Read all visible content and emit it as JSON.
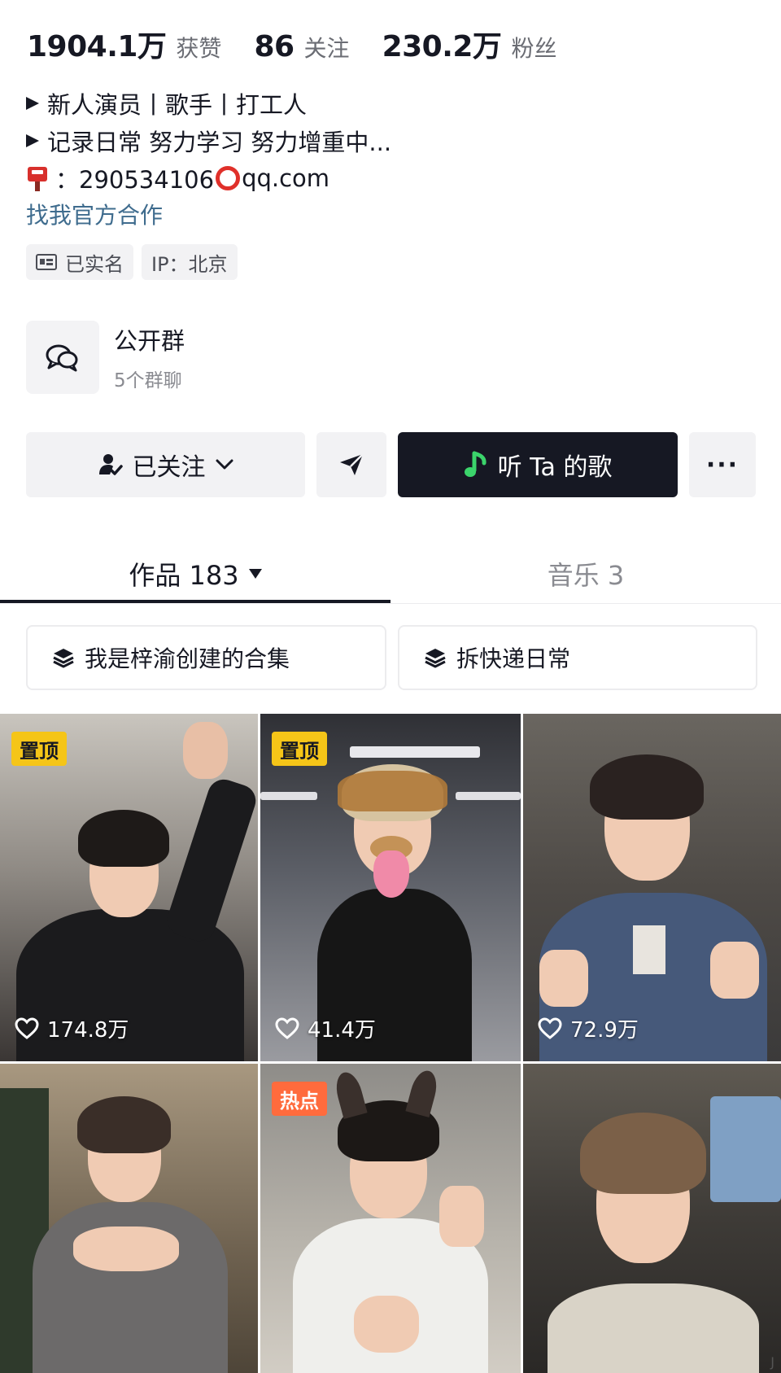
{
  "stats": {
    "likes_value": "1904.1万",
    "likes_label": "获赞",
    "following_value": "86",
    "following_label": "关注",
    "followers_value": "230.2万",
    "followers_label": "粉丝"
  },
  "bio": {
    "line1": "新人演员丨歌手丨打工人",
    "line2": "记录日常 努力学习 努力增重中...",
    "contact_prefix": "：290534106",
    "contact_suffix": "qq.com",
    "official_link": "找我官方合作"
  },
  "tags": {
    "verified": "已实名",
    "ip": "IP：北京"
  },
  "group": {
    "title": "公开群",
    "subtitle": "5个群聊"
  },
  "actions": {
    "follow_label": "已关注",
    "song_label": "听 Ta 的歌",
    "more_label": "···"
  },
  "tabs": {
    "works_label": "作品 183",
    "music_label": "音乐 3"
  },
  "collections": {
    "first": "我是梓渝创建的合集",
    "second": "拆快递日常"
  },
  "videos": [
    {
      "badge": "置顶",
      "likes": "174.8万"
    },
    {
      "badge": "置顶",
      "likes": "41.4万"
    },
    {
      "badge": "",
      "likes": "72.9万"
    },
    {
      "badge": "",
      "likes": ""
    },
    {
      "badge": "热点",
      "likes": ""
    },
    {
      "badge": "",
      "likes": ""
    }
  ],
  "colors": {
    "accent_dark": "#161823",
    "link": "#3f6c8e",
    "pin_badge": "#f5c518",
    "hot_badge": "#ff6b3d",
    "music_green": "#3bd46b"
  }
}
